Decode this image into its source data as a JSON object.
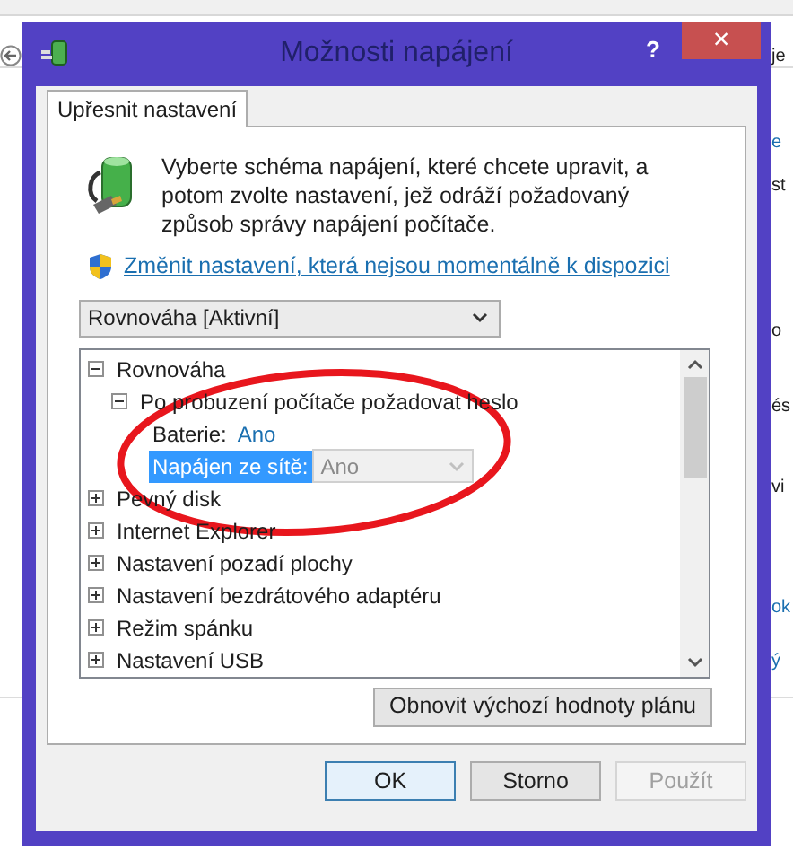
{
  "background_window": {
    "fragments": [
      "je",
      "e",
      "st",
      "o",
      "és",
      "vi",
      "ok",
      "ý"
    ]
  },
  "window": {
    "title": "Možnosti napájení",
    "help": "?",
    "close": "×"
  },
  "tabs": [
    {
      "label": "Upřesnit nastavení",
      "selected": true
    }
  ],
  "intro": "Vyberte schéma napájení, které chcete upravit, a potom zvolte nastavení, jež odráží požadovaný způsob správy napájení počítače.",
  "admin_link": "Změnit nastavení, která nejsou momentálně k dispozici",
  "plan_select": {
    "value": "Rovnováha [Aktivní]"
  },
  "tree": [
    {
      "label": "Rovnováha",
      "expanded": true,
      "children": [
        {
          "label": "Po probuzení počítače požadovat heslo",
          "expanded": true,
          "children": [
            {
              "kind": "value",
              "label": "Baterie:",
              "value": "Ano",
              "selected": false
            },
            {
              "kind": "dropdown",
              "label": "Napájen ze sítě:",
              "value": "Ano",
              "selected": true
            }
          ]
        }
      ]
    },
    {
      "label": "Pevný disk",
      "expanded": false
    },
    {
      "label": "Internet Explorer",
      "expanded": false
    },
    {
      "label": "Nastavení pozadí plochy",
      "expanded": false
    },
    {
      "label": "Nastavení bezdrátového adaptéru",
      "expanded": false
    },
    {
      "label": "Režim spánku",
      "expanded": false
    },
    {
      "label": "Nastavení USB",
      "expanded": false
    }
  ],
  "restore_button": "Obnovit výchozí hodnoty plánu",
  "buttons": [
    {
      "label": "OK",
      "disabled": false,
      "default": true
    },
    {
      "label": "Storno",
      "disabled": false,
      "default": false
    },
    {
      "label": "Použít",
      "disabled": true,
      "default": false
    }
  ]
}
